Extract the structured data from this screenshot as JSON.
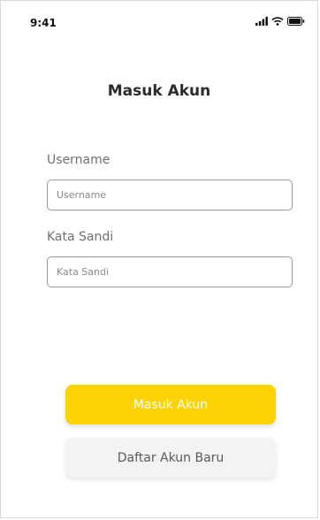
{
  "status_bar": {
    "time": "9:41",
    "icons": [
      "signal-icon",
      "wifi-icon",
      "battery-icon"
    ]
  },
  "page": {
    "title": "Masuk Akun"
  },
  "form": {
    "username": {
      "label": "Username",
      "placeholder": "Username",
      "value": ""
    },
    "password": {
      "label": "Kata Sandi",
      "placeholder": "Kata Sandi",
      "value": ""
    }
  },
  "actions": {
    "login_label": "Masuk Akun",
    "register_label": "Daftar Akun Baru"
  },
  "colors": {
    "accent": "#fdd303",
    "secondary_button": "#f3f3f3",
    "input_border": "#9a9a9a"
  }
}
